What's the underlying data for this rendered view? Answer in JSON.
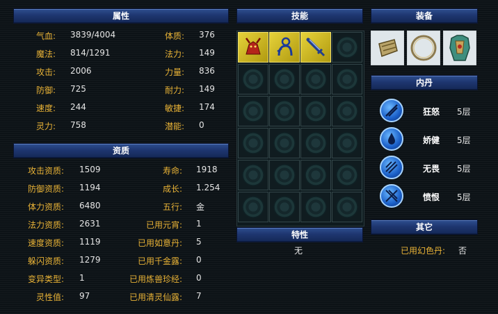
{
  "headers": {
    "attributes": "属性",
    "skills": "技能",
    "equipment": "装备",
    "aptitude": "资质",
    "neidan": "内丹",
    "traits": "特性",
    "other": "其它"
  },
  "attributes": {
    "left": [
      {
        "label": "气血:",
        "value": "3839/4004"
      },
      {
        "label": "魔法:",
        "value": "814/1291"
      },
      {
        "label": "攻击:",
        "value": "2006"
      },
      {
        "label": "防御:",
        "value": "725"
      },
      {
        "label": "速度:",
        "value": "244"
      },
      {
        "label": "灵力:",
        "value": "758"
      }
    ],
    "right": [
      {
        "label": "体质:",
        "value": "376"
      },
      {
        "label": "法力:",
        "value": "149"
      },
      {
        "label": "力量:",
        "value": "836"
      },
      {
        "label": "耐力:",
        "value": "149"
      },
      {
        "label": "敏捷:",
        "value": "174"
      },
      {
        "label": "潜能:",
        "value": "0"
      }
    ]
  },
  "aptitude": {
    "left": [
      {
        "label": "攻击资质:",
        "value": "1509"
      },
      {
        "label": "防御资质:",
        "value": "1194"
      },
      {
        "label": "体力资质:",
        "value": "6480"
      },
      {
        "label": "法力资质:",
        "value": "2631"
      },
      {
        "label": "速度资质:",
        "value": "1119"
      },
      {
        "label": "躲闪资质:",
        "value": "1279"
      },
      {
        "label": "变异类型:",
        "value": "1"
      },
      {
        "label": "灵性值:",
        "value": "97"
      }
    ],
    "right": [
      {
        "label": "寿命:",
        "value": "1918"
      },
      {
        "label": "成长:",
        "value": "1.254"
      },
      {
        "label": "五行:",
        "value": "金"
      },
      {
        "label": "已用元宵:",
        "value": "1"
      },
      {
        "label": "已用如意丹:",
        "value": "5"
      },
      {
        "label": "已用千金露:",
        "value": "0"
      },
      {
        "label": "已用炼兽珍经:",
        "value": "0"
      },
      {
        "label": "已用清灵仙露:",
        "value": "7"
      }
    ]
  },
  "skills": [
    {
      "icon": "red-horned-beast-skill-icon"
    },
    {
      "icon": "blue-figure-skill-icon"
    },
    {
      "icon": "sword-skill-icon"
    }
  ],
  "equipment": [
    {
      "icon": "bracer-icon"
    },
    {
      "icon": "ring-icon"
    },
    {
      "icon": "armor-icon"
    }
  ],
  "neidan": [
    {
      "name": "狂怒",
      "level": "5层",
      "icon": "sword-cross-icon"
    },
    {
      "name": "娇健",
      "level": "5层",
      "icon": "droplet-icon"
    },
    {
      "name": "无畏",
      "level": "5层",
      "icon": "arrows-icon"
    },
    {
      "name": "愤恨",
      "level": "5层",
      "icon": "crossed-blades-icon"
    }
  ],
  "traits": {
    "value": "无"
  },
  "other": {
    "label": "已用幻色丹:",
    "value": "否"
  },
  "colors": {
    "label": "#e8b236",
    "header_bg": "#1e3670",
    "background": "#0c1216"
  }
}
